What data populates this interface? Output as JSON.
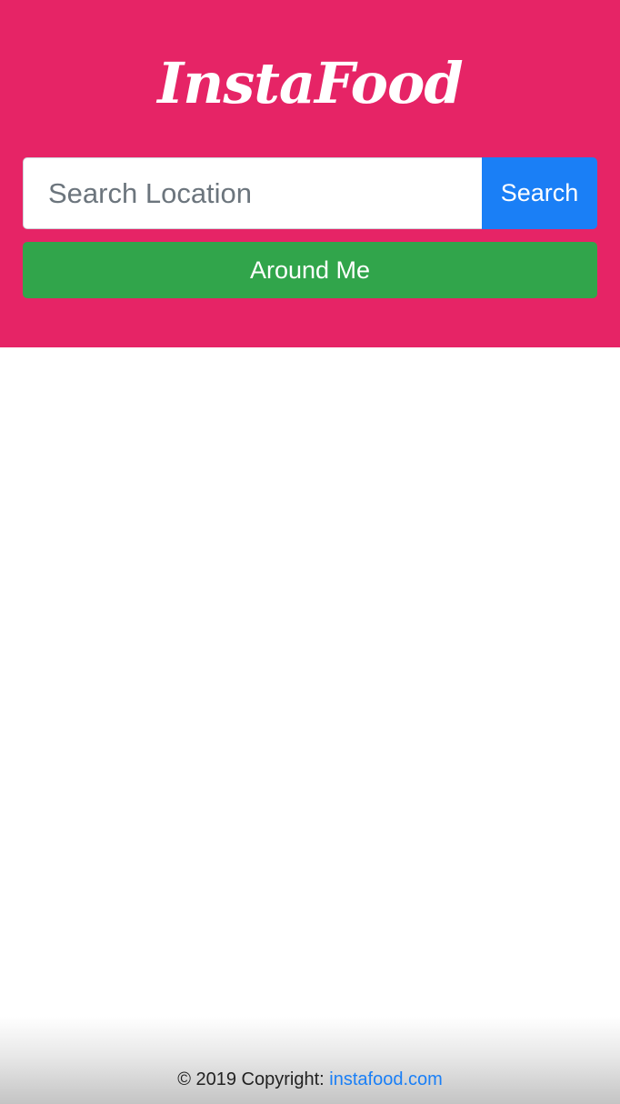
{
  "header": {
    "brand": "InstaFood",
    "background_color": "#e62466"
  },
  "search": {
    "placeholder": "Search Location",
    "value": "",
    "button_label": "Search",
    "button_color": "#1a7ff6"
  },
  "around_me": {
    "label": "Around Me",
    "color": "#31a54b"
  },
  "footer": {
    "copyright": "© 2019 Copyright:",
    "link_text": "instafood.com",
    "link_color": "#1a7ff6"
  }
}
